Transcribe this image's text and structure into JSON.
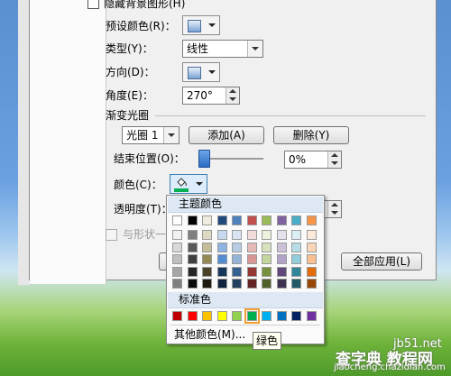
{
  "dialog": {
    "hide_background": "隐藏背景图形(H)",
    "preset_color_label": "预设颜色(R)：",
    "type_label": "类型(Y)：",
    "type_value": "线性",
    "direction_label": "方向(D)：",
    "angle_label": "角度(E)：",
    "angle_value": "270°",
    "gradient_stops_label": "渐变光圈",
    "stop_value": "光圈 1",
    "add_button": "添加(A)",
    "delete_button": "删除(Y)",
    "end_position_label": "结束位置(O)：",
    "end_position_value": "0%",
    "color_label": "颜色(C)：",
    "transparency_label": "透明度(T)：",
    "rotate_with_shape": "与形状一起旋转(W)",
    "apply_all_button": "全部应用(L)",
    "partial_button_text": "重"
  },
  "palette": {
    "theme_colors_label": "主题颜色",
    "standard_colors_label": "标准色",
    "more_colors_label": "其他颜色(M)...",
    "tooltip": "绿色",
    "theme_rows": [
      [
        "#ffffff",
        "#000000",
        "#eeece1",
        "#1f497d",
        "#4f81bd",
        "#c0504d",
        "#9bbb59",
        "#8064a2",
        "#4bacc6",
        "#f79646"
      ],
      [
        "#f2f2f2",
        "#7f7f7f",
        "#ddd9c3",
        "#c6d9f0",
        "#dbe5f1",
        "#f2dcdb",
        "#ebf1dd",
        "#e5e0ec",
        "#dbeef3",
        "#fdeada"
      ],
      [
        "#d8d8d8",
        "#595959",
        "#c4bd97",
        "#8db3e2",
        "#b8cce4",
        "#e5b9b7",
        "#d7e3bc",
        "#ccc1d9",
        "#b7dde8",
        "#fbd5b5"
      ],
      [
        "#bfbfbf",
        "#3f3f3f",
        "#938953",
        "#548dd4",
        "#95b3d7",
        "#d99694",
        "#c3d69b",
        "#b2a2c7",
        "#92cddc",
        "#fac08f"
      ],
      [
        "#a5a5a5",
        "#262626",
        "#494429",
        "#17365d",
        "#366092",
        "#953734",
        "#76923c",
        "#5f497a",
        "#31859b",
        "#e36c09"
      ],
      [
        "#7f7f7f",
        "#0c0c0c",
        "#1d1b10",
        "#0f243e",
        "#244061",
        "#632423",
        "#4f6128",
        "#3f3151",
        "#205867",
        "#974806"
      ]
    ],
    "standard_colors": [
      "#c00000",
      "#ff0000",
      "#ffc000",
      "#ffff00",
      "#92d050",
      "#00b050",
      "#00b0f0",
      "#0070c0",
      "#002060",
      "#7030a0"
    ],
    "selected_standard_index": 5
  },
  "watermark": {
    "site": "jb51.net",
    "line1": "查字典 教程网",
    "line2": "jiaocheng.chazidian.com"
  }
}
